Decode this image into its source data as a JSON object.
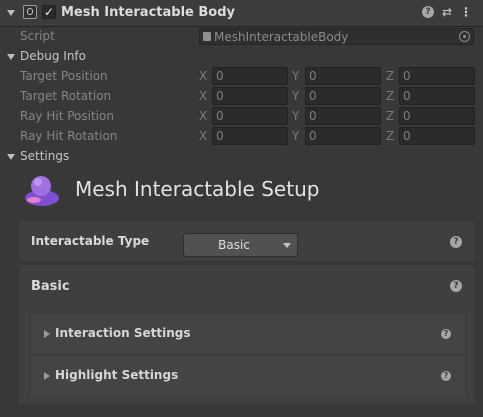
{
  "component": {
    "title": "Mesh Interactable Body",
    "enabled_checkmark": "✓"
  },
  "script_row": {
    "label": "Script",
    "value": "MeshInteractableBody"
  },
  "debug": {
    "heading": "Debug Info",
    "rows": [
      {
        "label": "Target Position",
        "x": "0",
        "y": "0",
        "z": "0"
      },
      {
        "label": "Target Rotation",
        "x": "0",
        "y": "0",
        "z": "0"
      },
      {
        "label": "Ray Hit Position",
        "x": "0",
        "y": "0",
        "z": "0"
      },
      {
        "label": "Ray Hit Rotation",
        "x": "0",
        "y": "0",
        "z": "0"
      }
    ],
    "axis_labels": {
      "x": "X",
      "y": "Y",
      "z": "Z"
    }
  },
  "settings": {
    "heading": "Settings",
    "setup_title": "Mesh Interactable Setup",
    "interactable_type_label": "Interactable Type",
    "interactable_type_value": "Basic",
    "basic_heading": "Basic",
    "sections": [
      {
        "label": "Interaction Settings"
      },
      {
        "label": "Highlight Settings"
      }
    ]
  },
  "icons": {
    "help": "?",
    "presets": "⇄",
    "more": "⋮"
  },
  "colors": {
    "background": "#383838",
    "panel": "#3f3f3f",
    "accent_logo": "#a070e0"
  }
}
